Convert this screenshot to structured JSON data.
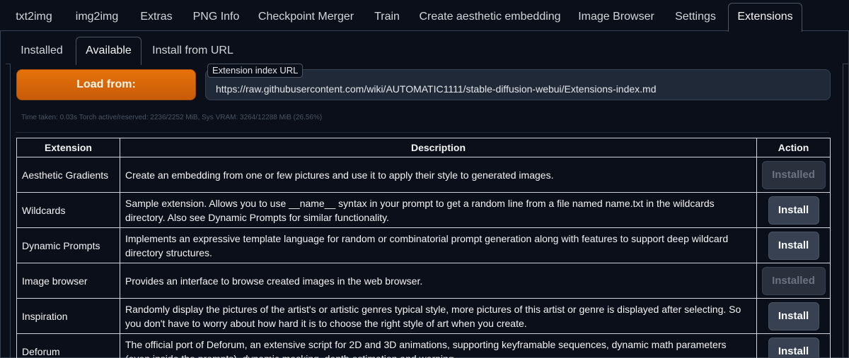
{
  "top_tabs": [
    "txt2img",
    "img2img",
    "Extras",
    "PNG Info",
    "Checkpoint Merger",
    "Train",
    "Create aesthetic embedding",
    "Image Browser",
    "Settings",
    "Extensions"
  ],
  "top_tab_selected": "Extensions",
  "sub_tabs": [
    "Installed",
    "Available",
    "Install from URL"
  ],
  "sub_tab_selected": "Available",
  "load_button_label": "Load from:",
  "index_url": {
    "label": "Extension index URL",
    "value": "https://raw.githubusercontent.com/wiki/AUTOMATIC1111/stable-diffusion-webui/Extensions-index.md"
  },
  "stats_text": "Time taken: 0.03s  Torch active/reserved: 2236/2252 MiB, Sys VRAM: 3264/12288 MiB (26.56%)",
  "table": {
    "headers": [
      "Extension",
      "Description",
      "Action"
    ],
    "rows": [
      {
        "name": "Aesthetic Gradients",
        "description": "Create an embedding from one or few pictures and use it to apply their style to generated images.",
        "action": "Installed",
        "installed": true
      },
      {
        "name": "Wildcards",
        "description": "Sample extension. Allows you to use __name__ syntax in your prompt to get a random line from a file named name.txt in the wildcards directory. Also see Dynamic Prompts for similar functionality.",
        "action": "Install",
        "installed": false
      },
      {
        "name": "Dynamic Prompts",
        "description": "Implements an expressive template language for random or combinatorial prompt generation along with features to support deep wildcard directory structures.",
        "action": "Install",
        "installed": false
      },
      {
        "name": "Image browser",
        "description": "Provides an interface to browse created images in the web browser.",
        "action": "Installed",
        "installed": true
      },
      {
        "name": "Inspiration",
        "description": "Randomly display the pictures of the artist's or artistic genres typical style, more pictures of this artist or genre is displayed after selecting. So you don't have to worry about how hard it is to choose the right style of art when you create.",
        "action": "Install",
        "installed": false
      },
      {
        "name": "Deforum",
        "description": "The official port of Deforum, an extensive script for 2D and 3D animations, supporting keyframable sequences, dynamic math parameters (even inside the prompts), dynamic masking, depth estimation and warping.",
        "action": "Install",
        "installed": false
      }
    ]
  },
  "colors": {
    "background": "#0b0f19",
    "accent_orange": "#e6720b",
    "border": "#374151",
    "table_border": "#d1d5db"
  }
}
